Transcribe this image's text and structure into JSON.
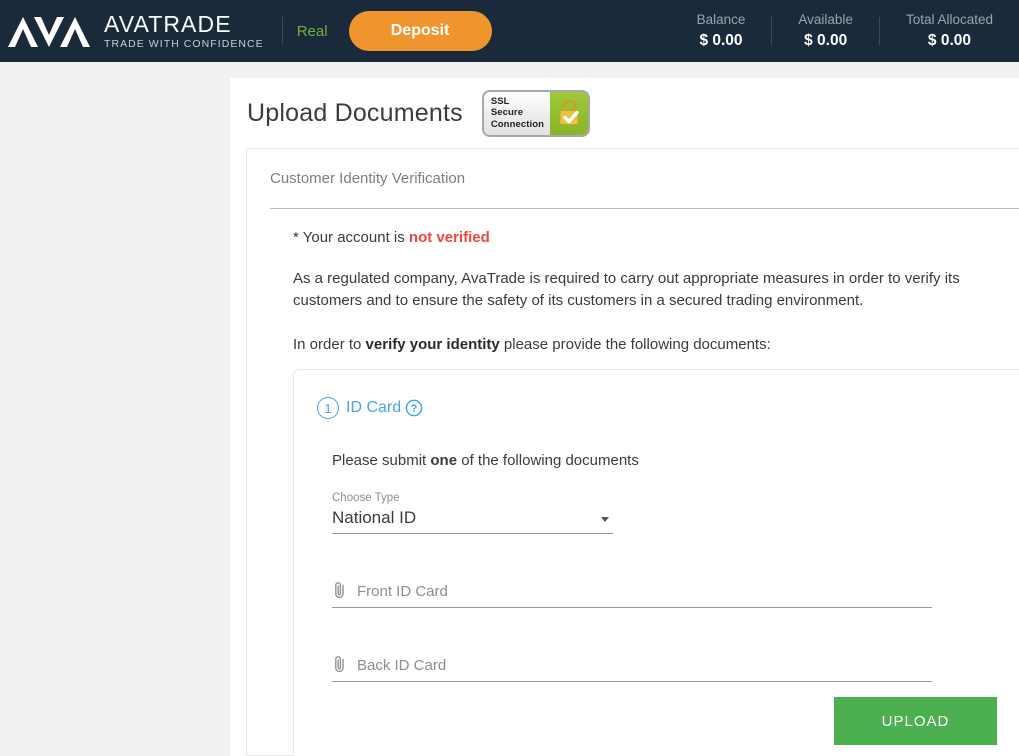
{
  "header": {
    "logo_name": "avatrade-logo",
    "brand_name": "AVATRADE",
    "brand_tagline": "TRADE WITH CONFIDENCE",
    "account_mode": "Real",
    "deposit_label": "Deposit",
    "accent_orange": "#f0952e",
    "accent_green": "#72b043",
    "background": "#1b2a3a",
    "balances": [
      {
        "label": "Balance",
        "value": "$ 0.00"
      },
      {
        "label": "Available",
        "value": "$ 0.00"
      },
      {
        "label": "Total Allocated",
        "value": "$ 0.00"
      }
    ]
  },
  "page": {
    "title": "Upload Documents",
    "ssl_badge": {
      "line1": "SSL",
      "line2": "Secure",
      "line3": "Connection",
      "icon": "padlock-check-icon",
      "panel_color": "#9fc93c"
    }
  },
  "card": {
    "heading": "Customer Identity Verification",
    "status_prefix": "* Your account is ",
    "status_value": "not verified",
    "status_color": "#f0463c",
    "paragraph1": "As a regulated company, AvaTrade is required to carry out appropriate measures in order to verify its customers and to ensure the safety of its customers in a secured trading environment.",
    "paragraph2_prefix": "In order to ",
    "paragraph2_bold": "verify your identity",
    "paragraph2_suffix": " please provide the following documents:"
  },
  "id_section": {
    "step_number": "1",
    "title": "ID Card",
    "help_icon": "question-mark-circle-icon",
    "accent_color": "#4aa3e8",
    "hint_prefix": "Please submit ",
    "hint_bold": "one",
    "hint_suffix": " of the following documents",
    "type_select": {
      "label": "Choose Type",
      "value": "National ID",
      "caret_icon": "chevron-down-icon"
    },
    "files": [
      {
        "icon": "paperclip-icon",
        "placeholder": "Front ID Card"
      },
      {
        "icon": "paperclip-icon",
        "placeholder": "Back ID Card"
      }
    ],
    "upload_label": "UPLOAD",
    "upload_color": "#4caf50"
  }
}
